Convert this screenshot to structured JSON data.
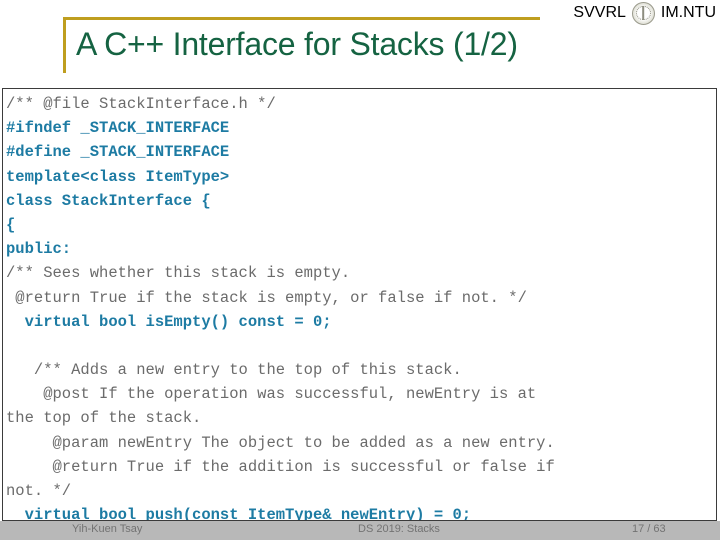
{
  "header": {
    "brand_left": "SVVRL",
    "brand_right": "IM.NTU",
    "seal_icon": "ntu-seal-icon",
    "accent_gold": "#bf9e1f"
  },
  "title": {
    "text": "A C++ Interface for Stacks (1/2)",
    "color": "#156342"
  },
  "code": {
    "comment_color": "#6b6b6b",
    "code_color": "#1d7ba3",
    "lines": [
      {
        "kind": "comment",
        "text": "/** @file StackInterface.h */"
      },
      {
        "kind": "code",
        "text": "#ifndef _STACK_INTERFACE"
      },
      {
        "kind": "code",
        "text": "#define _STACK_INTERFACE"
      },
      {
        "kind": "code",
        "text": "template<class ItemType>"
      },
      {
        "kind": "code",
        "text": "class StackInterface {"
      },
      {
        "kind": "code",
        "text": "{"
      },
      {
        "kind": "code",
        "text": "public:"
      },
      {
        "kind": "comment",
        "text": "/** Sees whether this stack is empty."
      },
      {
        "kind": "comment",
        "text": " @return True if the stack is empty, or false if not. */"
      },
      {
        "kind": "code",
        "text": "  virtual bool isEmpty() const = 0;"
      },
      {
        "kind": "blank",
        "text": " "
      },
      {
        "kind": "comment",
        "text": "   /** Adds a new entry to the top of this stack."
      },
      {
        "kind": "comment",
        "text": "    @post If the operation was successful, newEntry is at"
      },
      {
        "kind": "comment",
        "text": "the top of the stack."
      },
      {
        "kind": "comment",
        "text": "     @param newEntry The object to be added as a new entry."
      },
      {
        "kind": "comment",
        "text": "     @return True if the addition is successful or false if"
      },
      {
        "kind": "comment",
        "text": "not. */"
      },
      {
        "kind": "code",
        "text": "  virtual bool push(const ItemType& newEntry) = 0;"
      }
    ]
  },
  "footer": {
    "author": "Yih-Kuen Tsay",
    "course": "DS 2019: Stacks",
    "page": "17 / 63"
  }
}
